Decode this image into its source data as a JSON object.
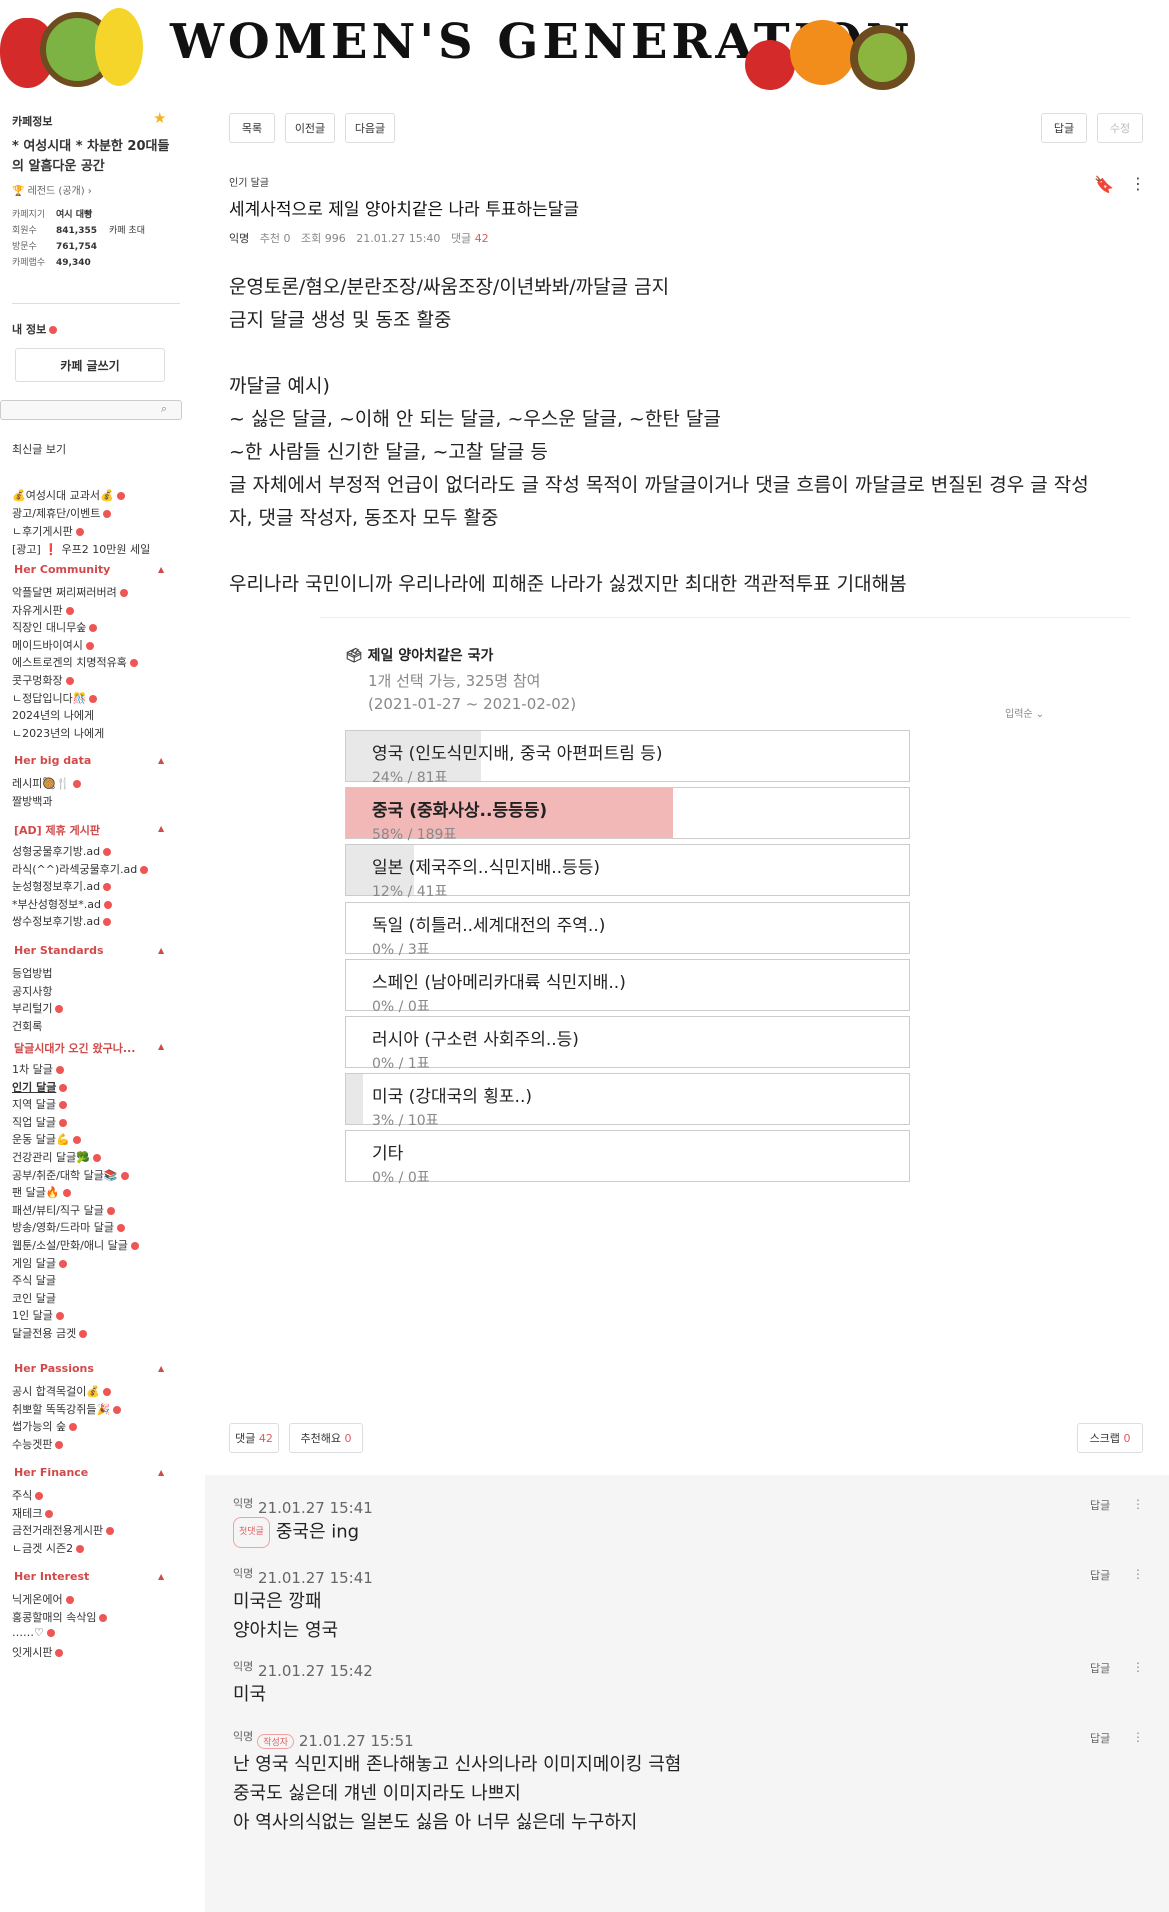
{
  "header": {
    "title": "WOMEN'S GENERATION"
  },
  "sidebar": {
    "cafe_info_label": "카페정보",
    "cafe_name": "* 여성시대 * 차분한 20대들의 알흠다운 공간",
    "cafe_grade": "레전드 (공개)",
    "stats": [
      {
        "label": "카페지기",
        "value": "여시 대빵"
      },
      {
        "label": "회원수",
        "value": "841,355",
        "extra": "카페 초대"
      },
      {
        "label": "방문수",
        "value": "761,754"
      },
      {
        "label": "카페랩수",
        "value": "49,340"
      }
    ],
    "my_info_label": "내 정보",
    "write_button": "카페 글쓰기",
    "search_placeholder": "",
    "recent_posts": "최신글 보기",
    "top_items": [
      "💰여성시대 교과서💰",
      "광고/제휴단/이벤트",
      "ㄴ후기게시판",
      "[광고] ❗ 우프2 10만원 세일"
    ],
    "groups": [
      {
        "head": "Her Community",
        "items": [
          "악플달면 쩌리쩌러버려",
          "자유게시판",
          "직장인 대니무숲",
          "메이드바이여시",
          "에스트로겐의 치명적유혹",
          "콧구멍화장",
          "ㄴ정답입니다🎊",
          "2024년의 나에게",
          "ㄴ2023년의 나에게"
        ]
      },
      {
        "head": "Her big data",
        "items": [
          "레시피🥘🍴",
          "짤방백과"
        ]
      },
      {
        "head": "[AD] 제휴 게시판",
        "items": [
          "성형궁물후기방.ad",
          "라식(^^)라섹궁물후기.ad",
          "눈성형정보후기.ad",
          "*부산성형정보*.ad",
          "쌍수정보후기방.ad"
        ]
      },
      {
        "head": "Her Standards",
        "items": [
          "등업방법",
          "공지사항",
          "부리털기",
          "건회록"
        ]
      },
      {
        "head": "달글시대가 오긴 왔구나...",
        "items": [
          "1차 달글",
          "인기 달글",
          "지역 달글",
          "직업 달글",
          "운동 달글💪",
          "건강관리 달글🥦",
          "공부/취준/대학 달글📚",
          "팬 달글🔥",
          "패션/뷰티/직구 달글",
          "방송/영화/드라마 달글",
          "웹툰/소설/만화/애니 달글",
          "게임 달글",
          "주식 달글",
          "코인 달글",
          "1인 달글",
          "달글전용 금겟"
        ]
      },
      {
        "head": "Her Passions",
        "items": [
          "공시 합격목걸이💰",
          "취뽀할 똑똑강쥐들🎉",
          "썹가능의 숲",
          "수능겟판"
        ]
      },
      {
        "head": "Her Finance",
        "items": [
          "주식",
          "재테크",
          "금전거래전용게시판",
          "ㄴ금겟 시즌2"
        ]
      },
      {
        "head": "Her Interest",
        "items": [
          "닉게온에어",
          "홍콩할매의 속삭임",
          "……♡",
          "잇게시판"
        ]
      }
    ]
  },
  "toolbar": {
    "list": "목록",
    "prev": "이전글",
    "next": "다음글",
    "reply": "답글",
    "edit": "수정"
  },
  "post": {
    "board": "인기 달글",
    "title": "세계사적으로 제일 양아치같은 나라 투표하는달글",
    "author": "익명",
    "recommend_label": "추천",
    "recommend": "0",
    "views_label": "조회",
    "views": "996",
    "date": "21.01.27 15:40",
    "comments_label": "댓글",
    "comments": "42",
    "body": [
      "운영토론/혐오/분란조장/싸움조장/이년봐봐/까달글 금지",
      "금지 달글 생성 및 동조 활중",
      "",
      "까달글 예시)",
      "~ 싫은 달글, ~이해 안 되는 달글, ~우스운 달글, ~한탄 달글",
      "~한 사람들 신기한 달글, ~고찰 달글 등",
      "글 자체에서 부정적 언급이 없더라도 글 작성 목적이 까달글이거나 댓글 흐름이 까달글로 변질된 경우 글 작성",
      "자, 댓글 작성자, 동조자 모두 활중",
      "",
      "우리나라 국민이니까 우리나라에 피해준 나라가 싫겠지만 최대한 객관적투표 기대해봄"
    ]
  },
  "poll": {
    "title": "제일 양아치같은 국가",
    "meta1": "1개 선택 가능, 325명 참여",
    "meta2": "(2021-01-27 ~ 2021-02-02)",
    "sort": "입력순 ⌄",
    "options": [
      {
        "label": "영국 (인도식민지배, 중국 아편퍼트림 등)",
        "stat": "24% / 81표",
        "pct": 0.24
      },
      {
        "label": "중국 (중화사상..등등등)",
        "stat": "58% / 189표",
        "pct": 0.58,
        "selected": true
      },
      {
        "label": "일본 (제국주의..식민지배..등등)",
        "stat": "12% / 41표",
        "pct": 0.12
      },
      {
        "label": "독일 (히틀러..세계대전의 주역..)",
        "stat": "0% / 3표",
        "pct": 0.0
      },
      {
        "label": "스페인 (남아메리카대륙 식민지배..)",
        "stat": "0% / 0표",
        "pct": 0.0
      },
      {
        "label": "러시아 (구소련 사회주의..등)",
        "stat": "0% / 1표",
        "pct": 0.0
      },
      {
        "label": "미국 (강대국의 횡포..)",
        "stat": "3% / 10표",
        "pct": 0.03
      },
      {
        "label": "기타",
        "stat": "0% / 0표",
        "pct": 0.0
      }
    ]
  },
  "footer_buttons": {
    "comments_label": "댓글",
    "comments_count": "42",
    "like_label": "추천해요",
    "like_count": "0",
    "scrap_label": "스크랩",
    "scrap_count": "0"
  },
  "comments": [
    {
      "author": "익명",
      "date": "21.01.27 15:41",
      "badge": "첫댓글",
      "lines": [
        "중국은 ing"
      ]
    },
    {
      "author": "익명",
      "date": "21.01.27 15:41",
      "badge": "",
      "lines": [
        "미국은 깡패",
        "양아치는 영국"
      ]
    },
    {
      "author": "익명",
      "date": "21.01.27 15:42",
      "badge": "",
      "lines": [
        "미국"
      ]
    },
    {
      "author": "익명",
      "date": "21.01.27 15:51",
      "badge": "작성자",
      "lines": [
        "난 영국 식민지배 존나해놓고 신사의나라 이미지메이킹 극혐",
        "중국도 싫은데 걔넨 이미지라도 나쁘지",
        "아 역사의식없는 일본도 싫음 아 너무 싫은데 누구하지"
      ]
    }
  ],
  "comment_reply": "답글",
  "colors": {
    "accent": "#e05a5a",
    "poll_selected": "#f2b8b8",
    "poll_bar": "#e8e8e8",
    "comment_bg": "#f5f5f5"
  }
}
